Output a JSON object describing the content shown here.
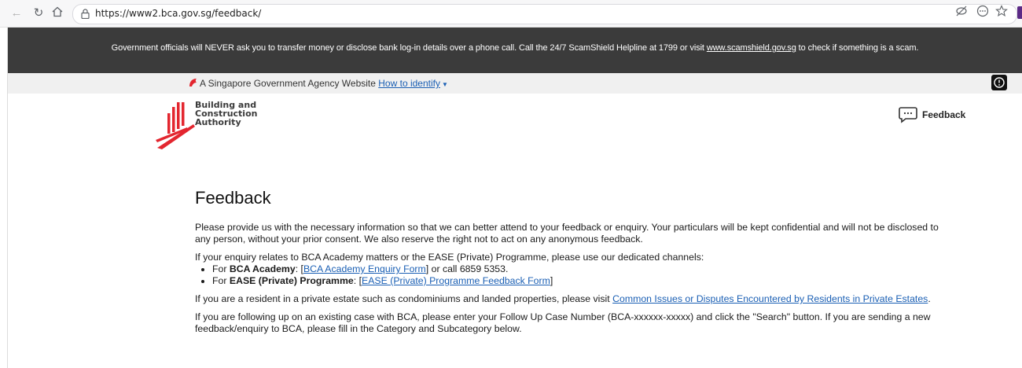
{
  "browser": {
    "url": "https://www2.bca.gov.sg/feedback/"
  },
  "scam_banner": {
    "text_before": "Government officials will NEVER ask you to transfer money or disclose bank log-in details over a phone call. Call the 24/7 ScamShield Helpline at 1799 or visit ",
    "link": "www.scamshield.gov.sg",
    "text_after": " to check if something is a scam."
  },
  "masthead": {
    "text": "A Singapore Government Agency Website",
    "identify_link": "How to identify"
  },
  "header": {
    "logo_lines": [
      "Building and",
      "Construction",
      "Authority"
    ],
    "feedback_label": "Feedback"
  },
  "content": {
    "title": "Feedback",
    "intro": "Please provide us with the necessary information so that we can better attend to your feedback or enquiry. Your particulars will be kept confidential and will not be disclosed to any person, without your prior consent. We also reserve the right not to act on any anonymous feedback.",
    "channels_intro": "If your enquiry relates to BCA Academy matters or the EASE (Private) Programme, please use our dedicated channels:",
    "academy": {
      "prefix": "For ",
      "name": "BCA Academy",
      "colon": ": [",
      "link": "BCA Academy Enquiry Form",
      "suffix": "] or call 6859 5353."
    },
    "ease": {
      "prefix": "For ",
      "name": "EASE (Private) Programme",
      "colon": ": [",
      "link": "EASE (Private) Programme Feedback Form",
      "suffix": "]"
    },
    "estate_text": "If you are a resident in a private estate such as condominiums and landed properties, please visit ",
    "estate_link": "Common Issues or Disputes Encountered by Residents in Private Estates",
    "estate_end": ".",
    "followup": "If you are following up on an existing case with BCA, please enter your Follow Up Case Number (BCA-xxxxxx-xxxxx) and click the \"Search\" button. If you are sending a new feedback/enquiry to BCA, please fill in the Category and Subcategory below."
  },
  "colors": {
    "banner_bg": "#3b3b3b",
    "brand_red": "#e3262f",
    "link": "#1a5fb4"
  }
}
